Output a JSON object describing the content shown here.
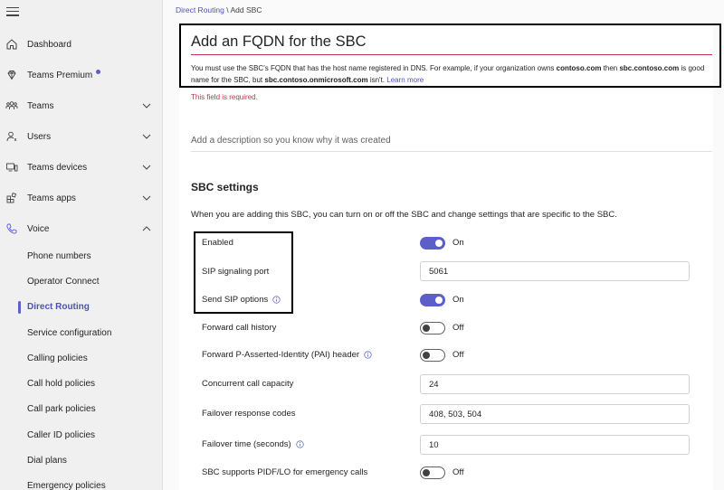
{
  "sidebar": {
    "items": [
      {
        "label": "Dashboard",
        "icon": "home-icon"
      },
      {
        "label": "Teams Premium",
        "icon": "diamond-icon"
      },
      {
        "label": "Teams",
        "icon": "people-team-icon"
      },
      {
        "label": "Users",
        "icon": "person-icon"
      },
      {
        "label": "Teams devices",
        "icon": "devices-icon"
      },
      {
        "label": "Teams apps",
        "icon": "apps-icon"
      },
      {
        "label": "Voice",
        "icon": "phone-icon"
      }
    ],
    "voice_subitems": [
      "Phone numbers",
      "Operator Connect",
      "Direct Routing",
      "Service configuration",
      "Calling policies",
      "Call hold policies",
      "Call park policies",
      "Caller ID policies",
      "Dial plans",
      "Emergency policies"
    ],
    "active_subitem": "Direct Routing",
    "accent_color": "#5b5fc7"
  },
  "breadcrumb": {
    "parent": "Direct Routing",
    "separator": "\\",
    "current": "Add SBC"
  },
  "fqdn": {
    "placeholder": "Add an FQDN for the SBC",
    "help_part1": "You must use the SBC's FQDN that has the host name registered in DNS. For example, if your organization owns ",
    "help_bold1": "contoso.com",
    "help_part2": " then ",
    "help_bold2": "sbc.contoso.com",
    "help_part3": " is good name for the SBC, but ",
    "help_bold3": "sbc.contoso.onmicrosoft.com",
    "help_part4": " isn't. ",
    "learn_more": "Learn more",
    "error": "This field is required."
  },
  "description": {
    "placeholder": "Add a description so you know why it was created"
  },
  "sbc_settings": {
    "title": "SBC settings",
    "intro": "When you are adding this SBC, you can turn on or off the SBC and change settings that are specific to the SBC.",
    "enabled": {
      "label": "Enabled",
      "state": "On"
    },
    "sip_port": {
      "label": "SIP signaling port",
      "value": "5061"
    },
    "send_sip_options": {
      "label": "Send SIP options",
      "state": "On"
    },
    "forward_call_history": {
      "label": "Forward call history",
      "state": "Off"
    },
    "forward_pai": {
      "label": "Forward P-Asserted-Identity (PAI) header",
      "state": "Off"
    },
    "concurrent_capacity": {
      "label": "Concurrent call capacity",
      "value": "24"
    },
    "failover_codes": {
      "label": "Failover response codes",
      "value": "408, 503, 504"
    },
    "failover_time": {
      "label": "Failover time (seconds)",
      "value": "10"
    },
    "pidf_lo": {
      "label": "SBC supports PIDF/LO for emergency calls",
      "state": "Off"
    }
  }
}
